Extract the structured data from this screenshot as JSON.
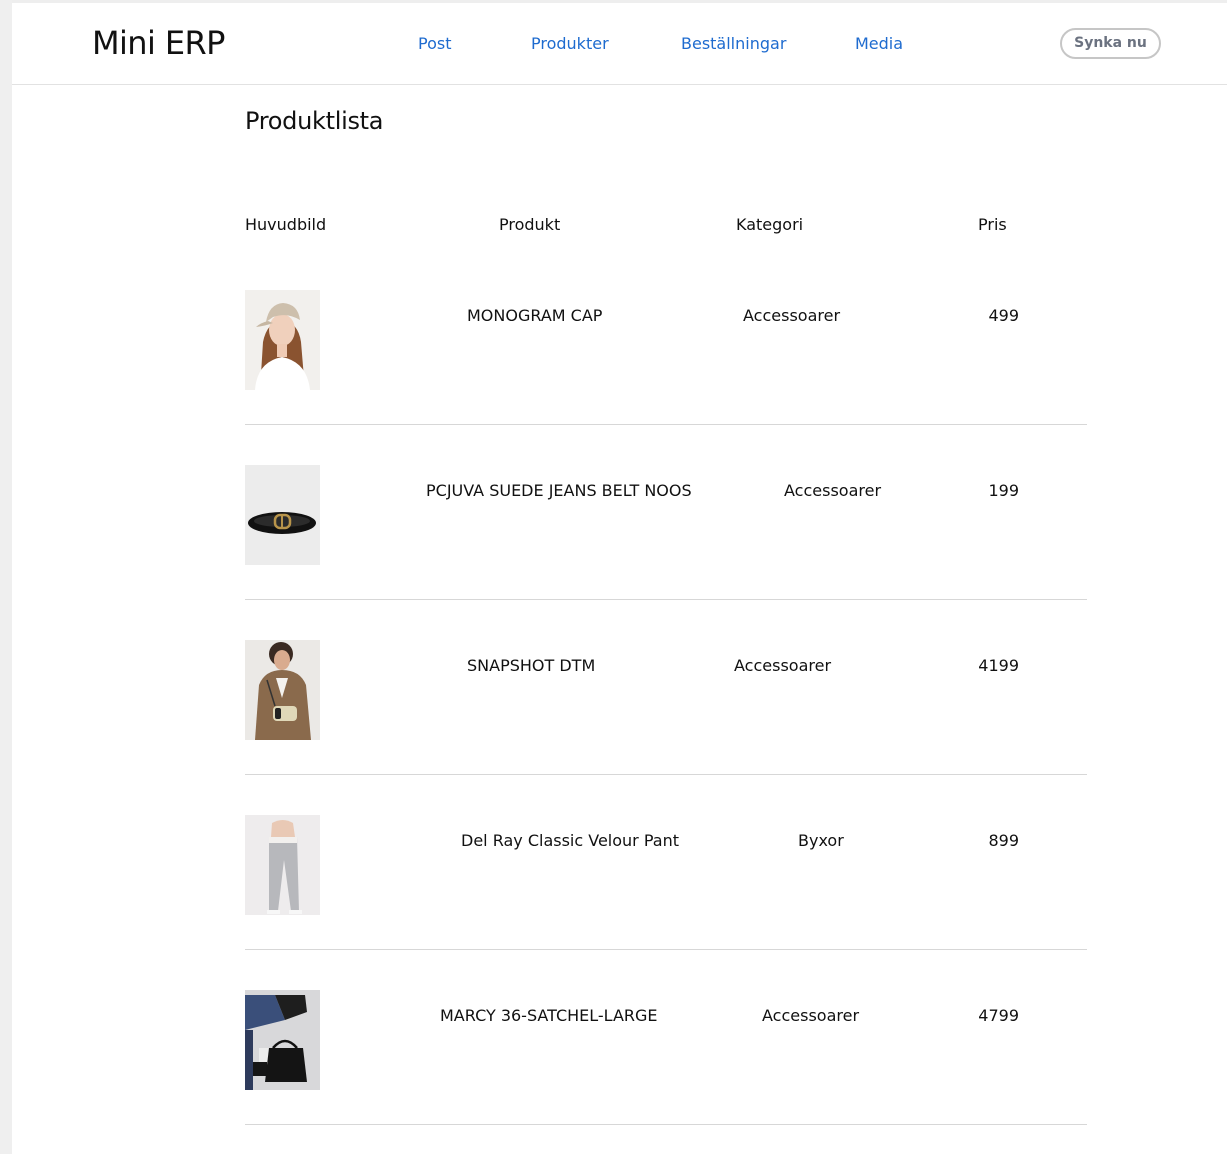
{
  "app": {
    "title": "Mini ERP"
  },
  "nav": {
    "items": [
      {
        "label": "Post"
      },
      {
        "label": "Produkter"
      },
      {
        "label": "Beställningar"
      },
      {
        "label": "Media"
      }
    ],
    "sync_label": "Synka nu"
  },
  "page": {
    "title": "Produktlista"
  },
  "table": {
    "headers": {
      "image": "Huvudbild",
      "product": "Produkt",
      "category": "Kategori",
      "price": "Pris"
    },
    "rows": [
      {
        "product": "MONOGRAM CAP",
        "category": "Accessoarer",
        "price": "499",
        "image_icon": "woman-cap-photo"
      },
      {
        "product": "PCJUVA SUEDE JEANS BELT NOOS",
        "category": "Accessoarer",
        "price": "199",
        "image_icon": "belt-photo"
      },
      {
        "product": "SNAPSHOT DTM",
        "category": "Accessoarer",
        "price": "4199",
        "image_icon": "camera-bag-photo"
      },
      {
        "product": "Del Ray Classic Velour Pant",
        "category": "Byxor",
        "price": "899",
        "image_icon": "velour-pant-photo"
      },
      {
        "product": "MARCY 36-SATCHEL-LARGE",
        "category": "Accessoarer",
        "price": "4799",
        "image_icon": "satchel-bag-photo"
      }
    ]
  },
  "colors": {
    "nav_link": "#1e6bcf",
    "sync_button_border": "#c6c6c6",
    "sync_button_text": "#6b7280",
    "row_divider": "#d7d7d7"
  }
}
